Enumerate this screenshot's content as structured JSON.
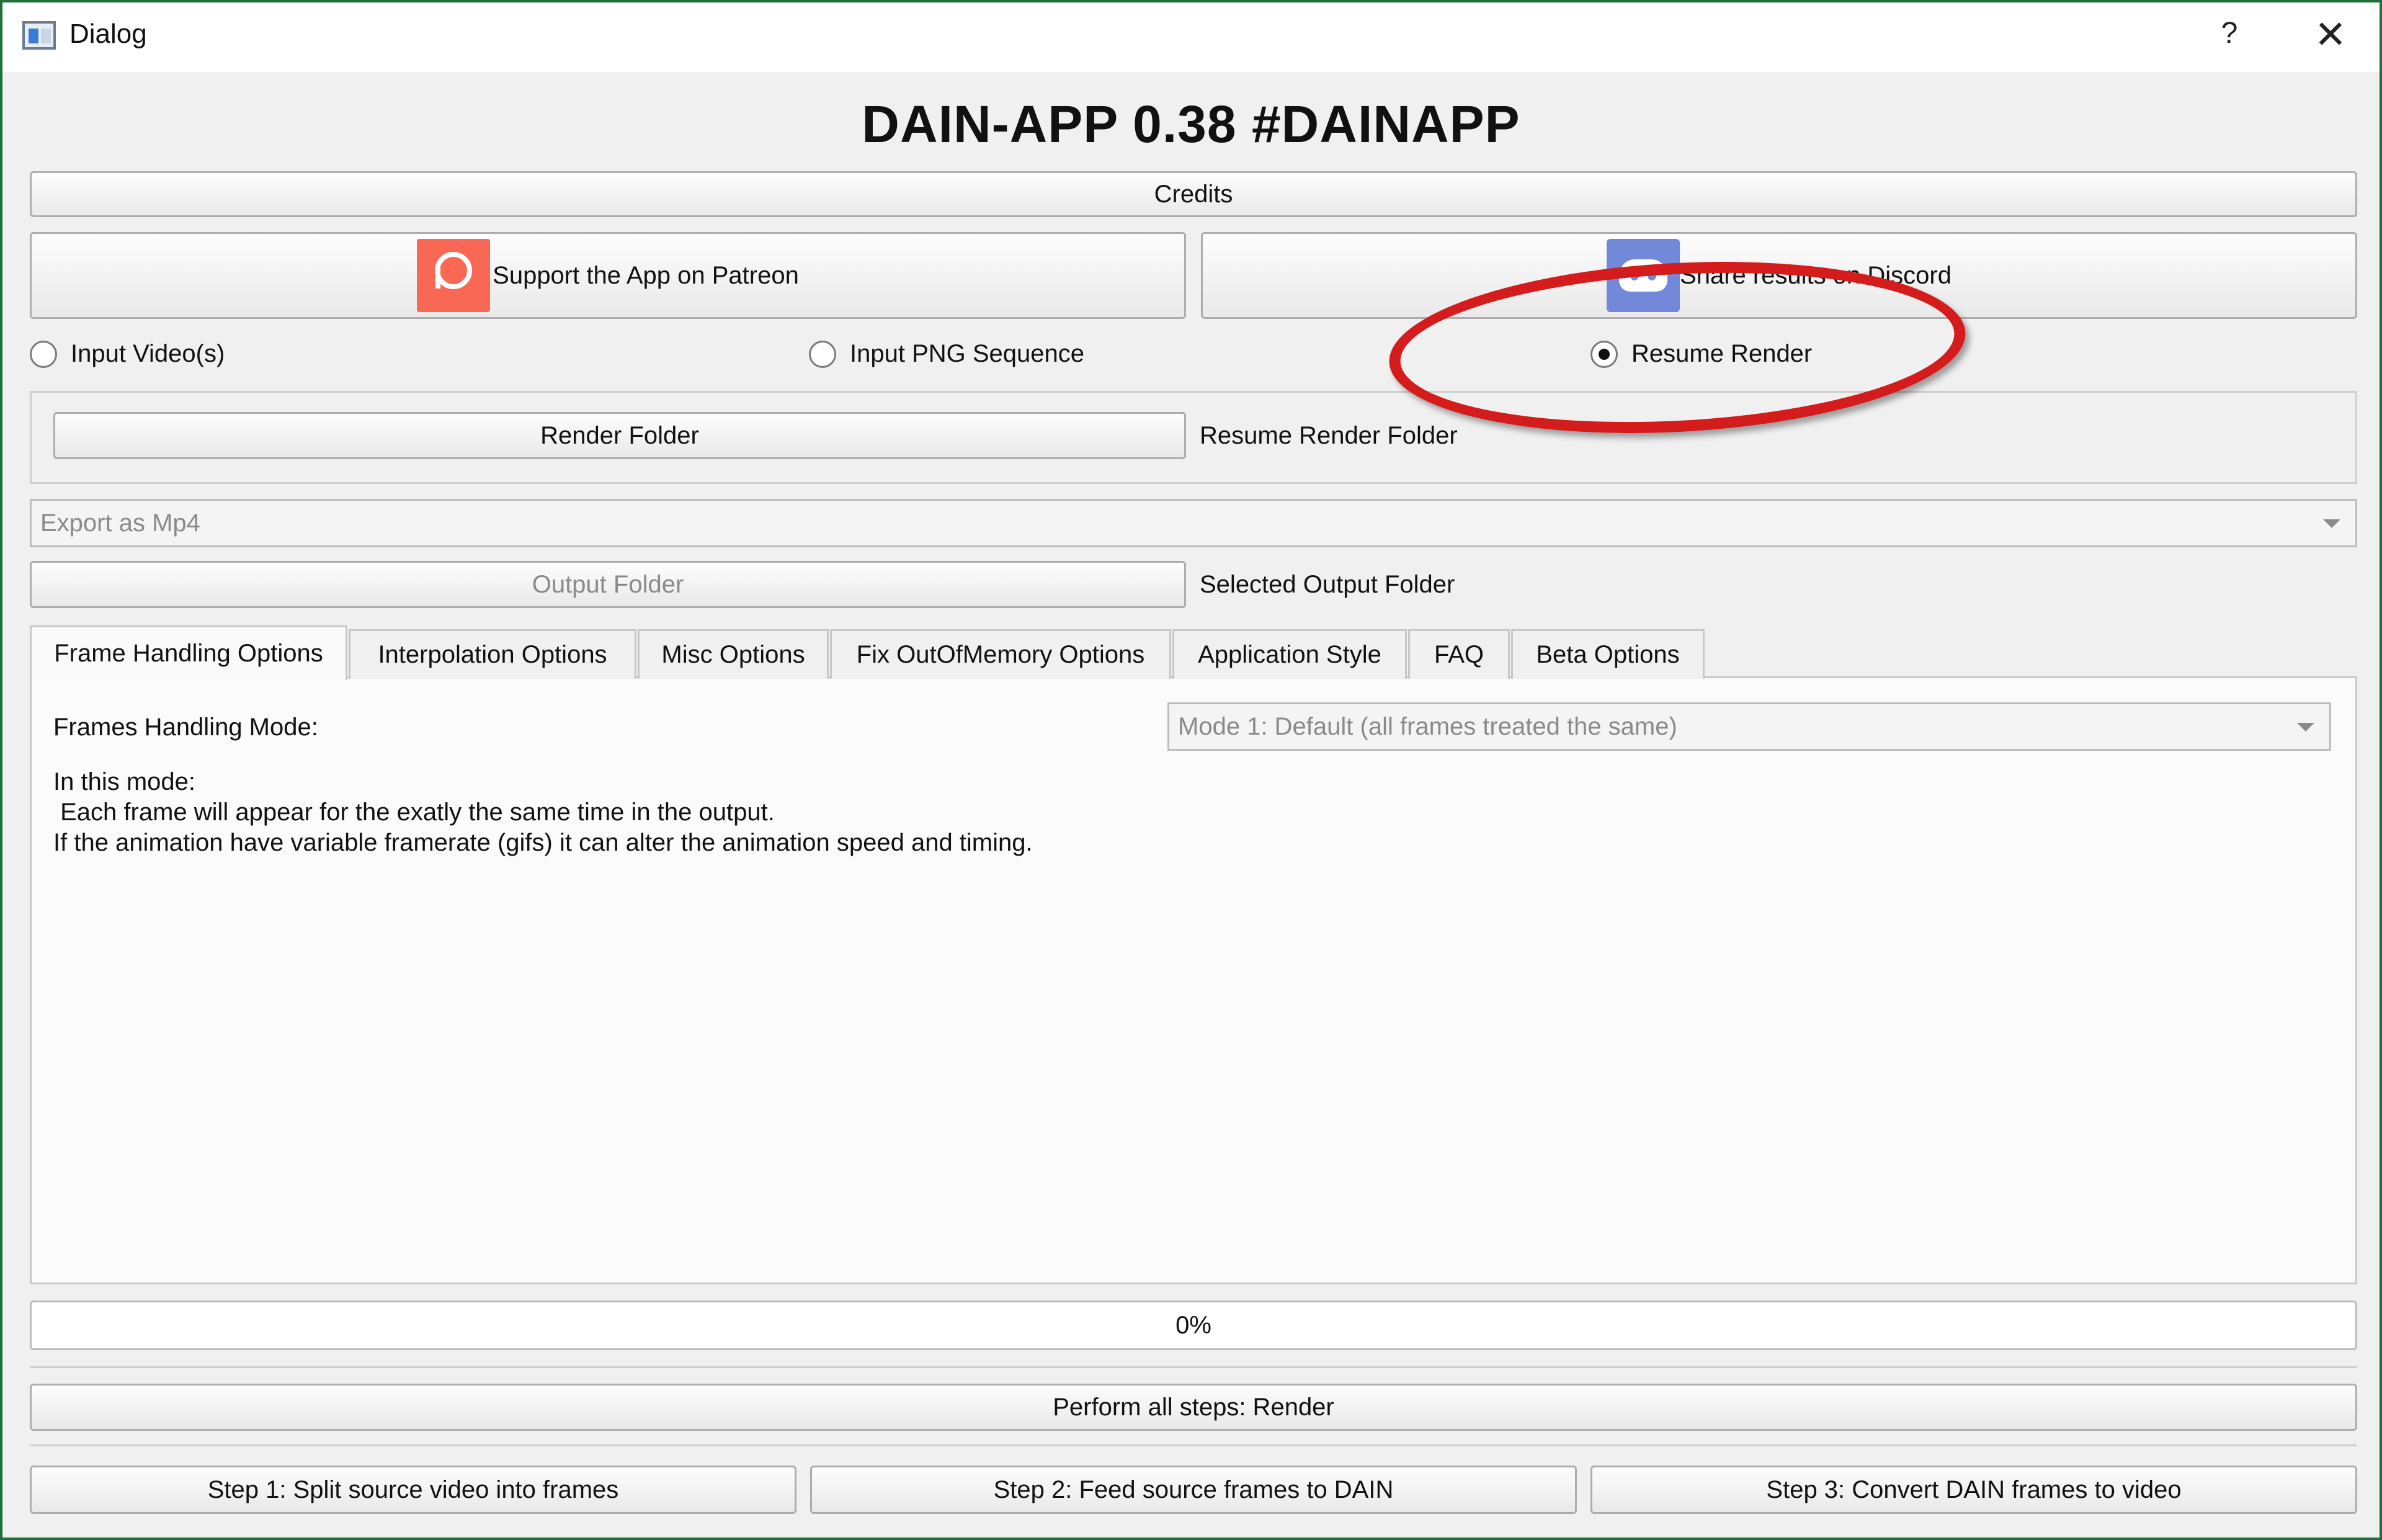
{
  "window": {
    "title": "Dialog",
    "help_glyph": "?",
    "close_glyph": "✕"
  },
  "heading": "DAIN-APP 0.38 #DAINAPP",
  "buttons": {
    "credits": "Credits",
    "patreon": "Support the App on Patreon",
    "discord": "Share results on Discord",
    "render_folder": "Render Folder",
    "output_folder": "Output Folder",
    "perform_all": "Perform all steps: Render",
    "step1": "Step 1: Split source video into frames",
    "step2": "Step 2: Feed source frames to DAIN",
    "step3": "Step 3: Convert DAIN frames to video"
  },
  "input_mode": {
    "options": [
      "Input Video(s)",
      "Input PNG Sequence",
      "Resume Render"
    ],
    "selected": "Resume Render"
  },
  "labels": {
    "resume_render_folder": "Resume Render Folder",
    "selected_output_folder": "Selected Output Folder"
  },
  "export_format": {
    "value": "Export as Mp4"
  },
  "tabs": [
    "Frame Handling Options",
    "Interpolation Options",
    "Misc Options",
    "Fix OutOfMemory Options",
    "Application Style",
    "FAQ",
    "Beta Options"
  ],
  "active_tab": "Frame Handling Options",
  "frame_handling": {
    "mode_label": "Frames Handling Mode:",
    "mode_value": "Mode 1: Default (all frames treated the same)",
    "description": [
      "In this mode:",
      " Each frame will appear for the exatly the same time in the output.",
      "If the animation have variable framerate (gifs) it can alter the animation speed and timing."
    ]
  },
  "progress": {
    "text": "0%",
    "value": 0
  },
  "annotation": {
    "color": "#d41c1c"
  }
}
